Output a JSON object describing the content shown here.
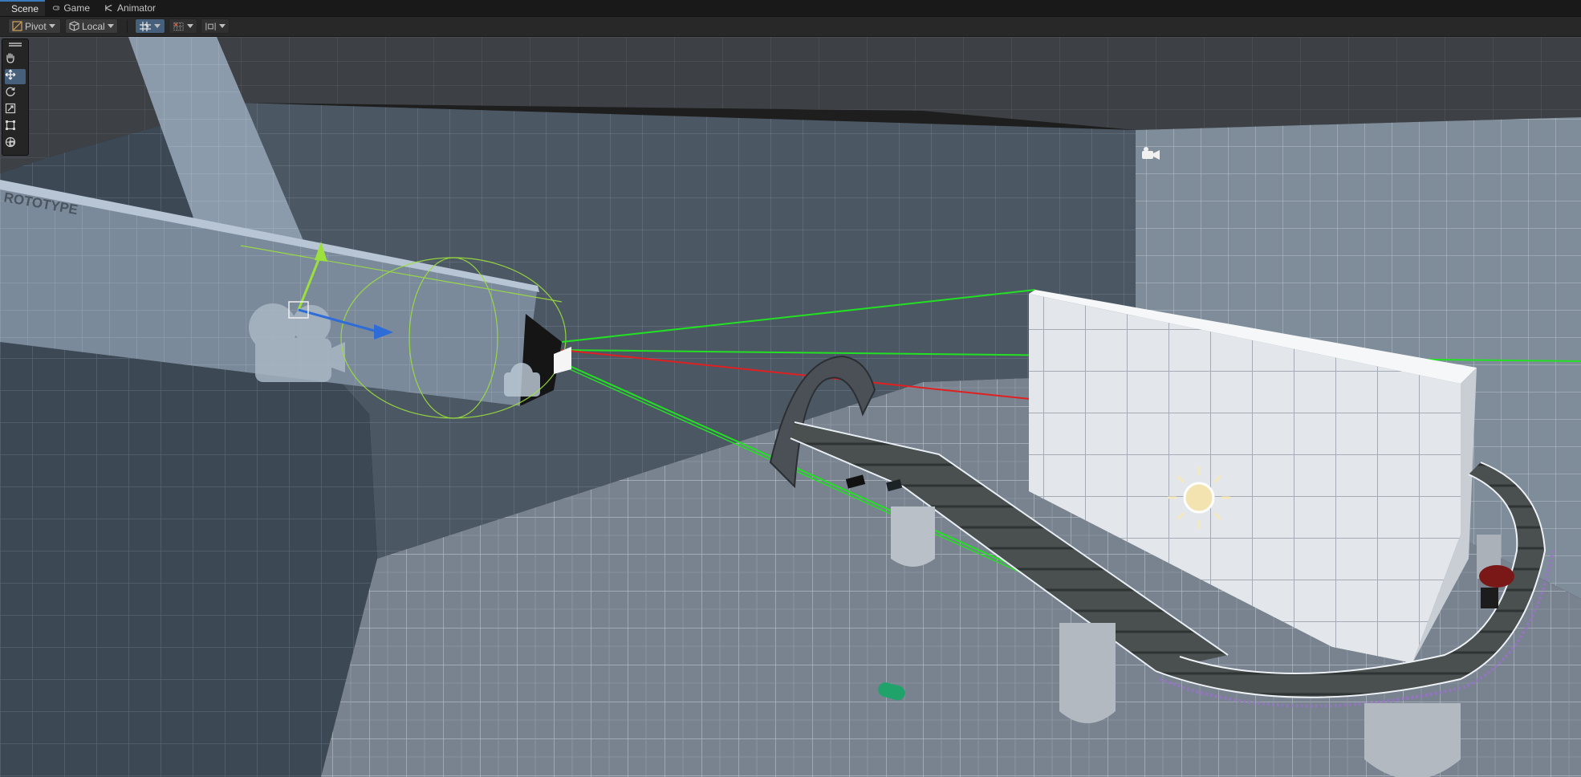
{
  "tabs": [
    {
      "label": "Scene",
      "icon": "grid-icon",
      "active": true
    },
    {
      "label": "Game",
      "icon": "gamepad-icon",
      "active": false
    },
    {
      "label": "Animator",
      "icon": "animator-icon",
      "active": false
    }
  ],
  "toolbar": {
    "pivot_label": "Pivot",
    "local_label": "Local"
  },
  "tools": [
    {
      "name": "hand-tool-icon"
    },
    {
      "name": "move-tool-icon",
      "selected": true
    },
    {
      "name": "rotate-tool-icon"
    },
    {
      "name": "scale-tool-icon"
    },
    {
      "name": "rect-tool-icon"
    },
    {
      "name": "transform-tool-icon"
    }
  ],
  "scene": {
    "wall_text": "ROTOTYPE",
    "colors": {
      "gizmo_x": "#ff2020",
      "gizmo_y": "#9be03c",
      "gizmo_z": "#2e6cd8",
      "frustum": "#20e020",
      "floor": "#7c8793",
      "wall": "#4f5a67",
      "ceiling": "#3e4247"
    }
  }
}
